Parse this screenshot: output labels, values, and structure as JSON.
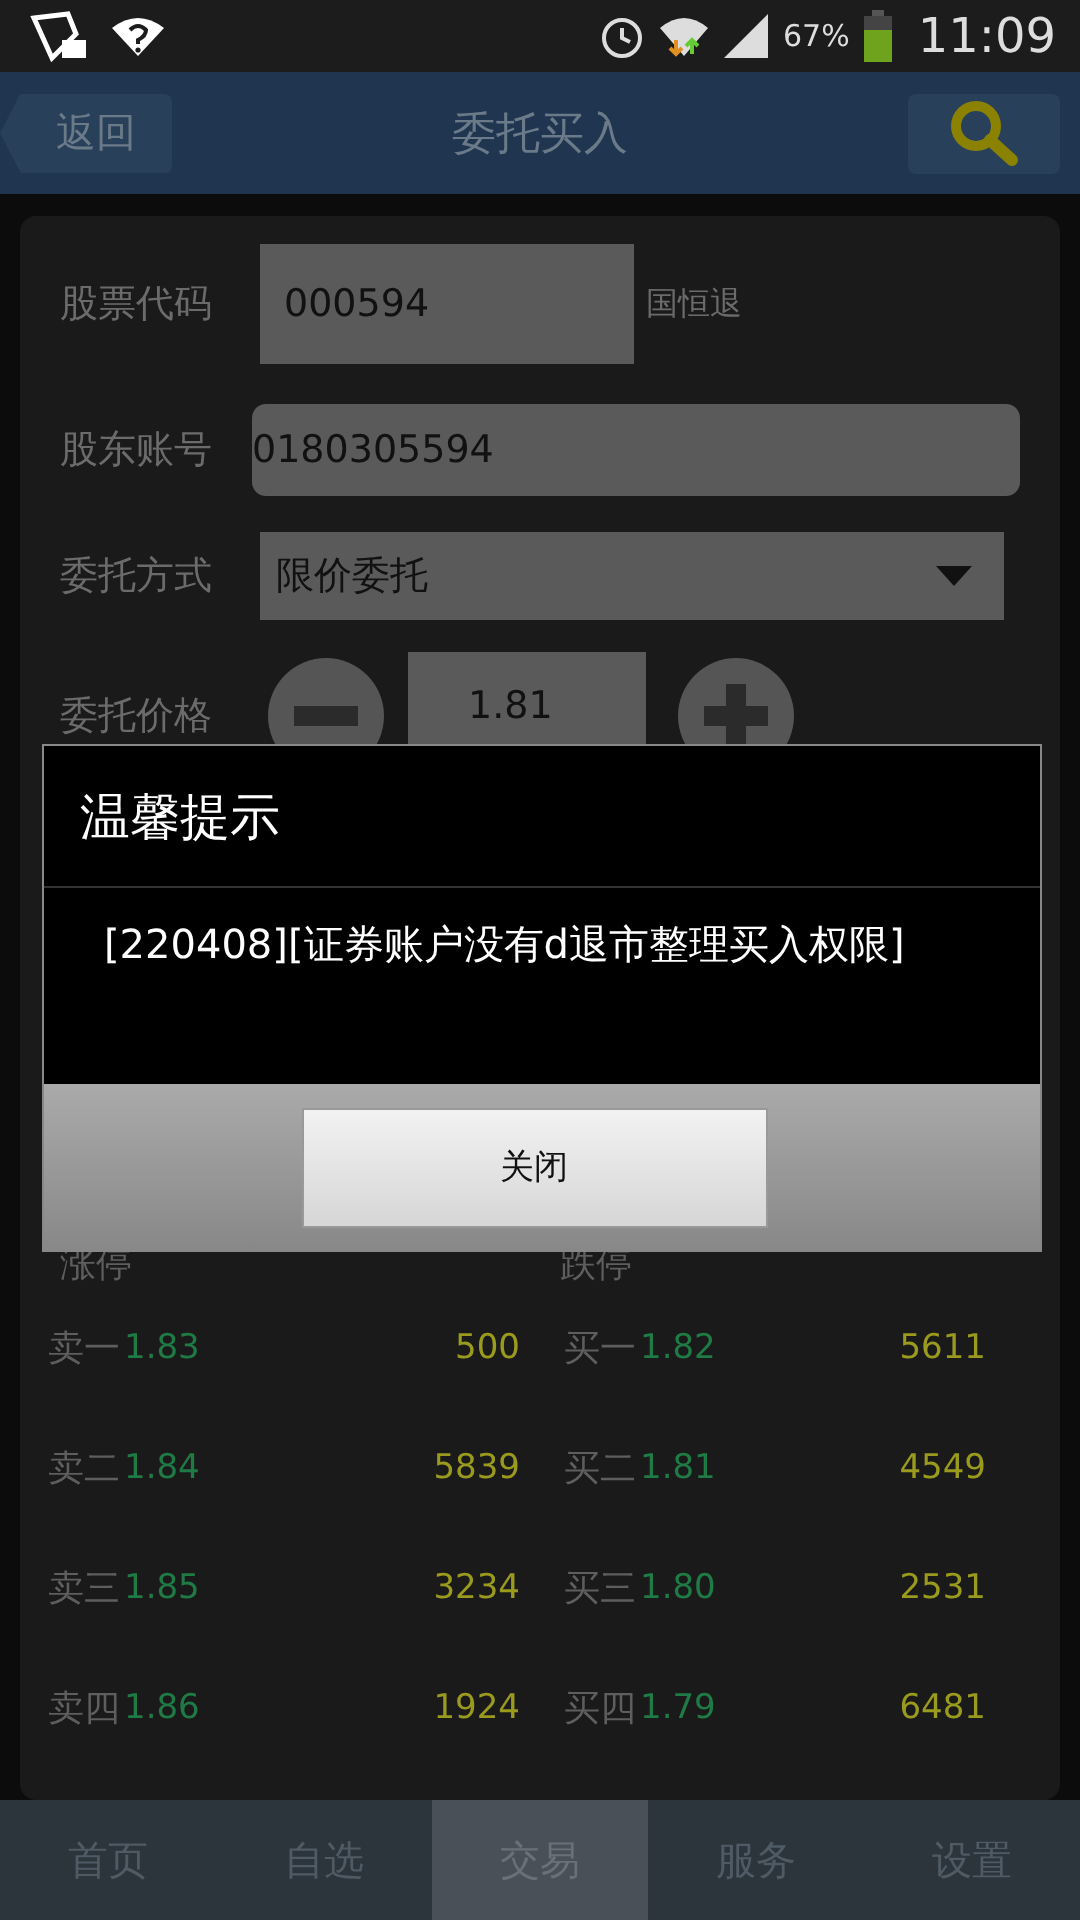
{
  "status_bar": {
    "battery_text": "67%",
    "time": "11:09"
  },
  "header": {
    "back": "返回",
    "title": "委托买入"
  },
  "form": {
    "stock_code": {
      "label": "股票代码",
      "value": "000594",
      "stock_name": "国恒退"
    },
    "account": {
      "label": "股东账号",
      "value": "0180305594"
    },
    "order_type": {
      "label": "委托方式",
      "value": "限价委托"
    },
    "price": {
      "label": "委托价格",
      "value": "1.81"
    }
  },
  "limits": [
    {
      "label": "涨停"
    },
    {
      "label": "跌停"
    }
  ],
  "order_book": {
    "sell": [
      {
        "label": "卖一",
        "price": "1.83",
        "volume": "500"
      },
      {
        "label": "卖二",
        "price": "1.84",
        "volume": "5839"
      },
      {
        "label": "卖三",
        "price": "1.85",
        "volume": "3234"
      },
      {
        "label": "卖四",
        "price": "1.86",
        "volume": "1924"
      }
    ],
    "buy": [
      {
        "label": "买一",
        "price": "1.82",
        "volume": "5611"
      },
      {
        "label": "买二",
        "price": "1.81",
        "volume": "4549"
      },
      {
        "label": "买三",
        "price": "1.80",
        "volume": "2531"
      },
      {
        "label": "买四",
        "price": "1.79",
        "volume": "6481"
      }
    ]
  },
  "dialog": {
    "title": "温馨提示",
    "message": "[220408][证券账户没有d退市整理买入权限]",
    "button": "关闭"
  },
  "nav": [
    {
      "label": "首页",
      "selected": false
    },
    {
      "label": "自选",
      "selected": false
    },
    {
      "label": "交易",
      "selected": true
    },
    {
      "label": "服务",
      "selected": false
    },
    {
      "label": "设置",
      "selected": false
    }
  ]
}
